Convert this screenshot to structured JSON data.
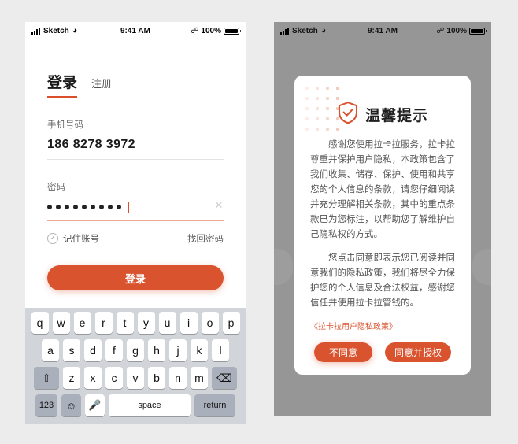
{
  "statusbar": {
    "carrier": "Sketch",
    "time": "9:41 AM",
    "battery_percent": "100%",
    "signal_icon": "signal-bars-icon",
    "wifi_icon": "wifi-icon",
    "bluetooth_icon": "bluetooth-icon",
    "battery_icon": "battery-full-icon"
  },
  "login": {
    "tabs": [
      {
        "label": "登录",
        "active": true
      },
      {
        "label": "注册",
        "active": false
      }
    ],
    "phone_field": {
      "label": "手机号码",
      "value": "186 8278 3972"
    },
    "password_field": {
      "label": "密码",
      "masked_value": "•••••••••",
      "dot_count": 9,
      "clear_icon": "close-x-icon"
    },
    "remember": {
      "label": "记住账号",
      "checked": true,
      "icon": "check-circle-icon"
    },
    "forgot_label": "找回密码",
    "submit_label": "登录",
    "accent_color": "#d9532f",
    "active_underline_color": "#eda791"
  },
  "keyboard": {
    "row1": [
      "q",
      "w",
      "e",
      "r",
      "t",
      "y",
      "u",
      "i",
      "o",
      "p"
    ],
    "row2": [
      "a",
      "s",
      "d",
      "f",
      "g",
      "h",
      "j",
      "k",
      "l"
    ],
    "row3": [
      "z",
      "x",
      "c",
      "v",
      "b",
      "n",
      "m"
    ],
    "shift_icon": "shift-up-icon",
    "delete_icon": "backspace-icon",
    "numbers_label": "123",
    "emoji_icon": "emoji-smiley-icon",
    "mic_icon": "microphone-icon",
    "space_label": "space",
    "return_label": "return"
  },
  "dialog": {
    "title": "温馨提示",
    "shield_icon": "shield-check-icon",
    "paragraphs": [
      "感谢您使用拉卡拉服务，拉卡拉尊重并保护用户隐私，本政策包含了我们收集、储存、保护、使用和共享您的个人信息的条款，请您仔细阅读并充分理解相关条款，其中的重点条款已为您标注，以帮助您了解维护自己隐私权的方式。",
      "您点击同意即表示您已阅读并同意我们的隐私政策，我们将尽全力保护您的个人信息及合法权益，感谢您信任并使用拉卡拉管钱的。"
    ],
    "policy_link": "《拉卡拉用户隐私政策》",
    "decline_label": "不同意",
    "accept_label": "同意并授权",
    "overlay_color": "#969696",
    "accent_color": "#d9532f"
  }
}
